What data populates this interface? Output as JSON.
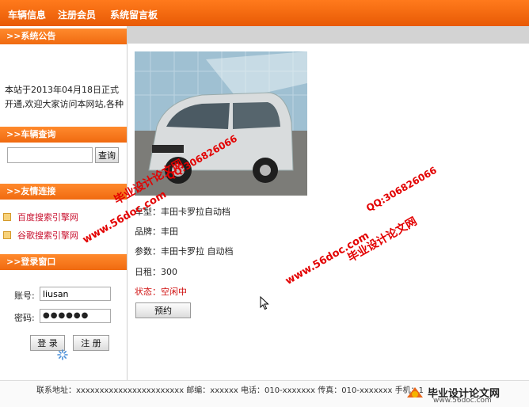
{
  "nav": {
    "items": [
      {
        "label": "车辆信息"
      },
      {
        "label": "注册会员"
      },
      {
        "label": "系统留言板"
      }
    ]
  },
  "sidebar": {
    "notice": {
      "title": ">>系统公告",
      "text": "本站于2013年04月18日正式开通,欢迎大家访问本网站,各种"
    },
    "search": {
      "title": ">>车辆查询",
      "value": "",
      "button": "查询"
    },
    "links": {
      "title": ">>友情连接",
      "items": [
        {
          "label": "百度搜索引擎网"
        },
        {
          "label": "谷歌搜索引擎网"
        }
      ]
    },
    "login": {
      "title": ">>登录窗口",
      "account_label": "账号:",
      "account_value": "liusan",
      "password_label": "密码:",
      "password_value": "●●●●●●",
      "login_button": "登 录",
      "register_button": "注 册"
    }
  },
  "car": {
    "type": "车型：丰田卡罗拉自动档",
    "brand": "品牌：丰田",
    "params": "参数：丰田卡罗拉 自动档",
    "rent": "日租：300",
    "status": "状态：空闲中",
    "book_button": "预约"
  },
  "watermarks": {
    "site1": "www.56doc.com",
    "qq1": "QQ:306826066",
    "brand1": "毕业设计论文网",
    "site2": "www.56doc.com",
    "qq2": "QQ:306826066",
    "brand2": "毕业设计论文网"
  },
  "footer": {
    "text": "联系地址：xxxxxxxxxxxxxxxxxxxxxxx    邮编：xxxxxx 电话：010-xxxxxxx    传真：010-xxxxxxx    手机：1",
    "logo": "毕业设计论文网",
    "logo_url": "www.56doc.com"
  },
  "colors": {
    "accent": "#f06a10",
    "status": "#d01010",
    "link": "#c8102e"
  }
}
